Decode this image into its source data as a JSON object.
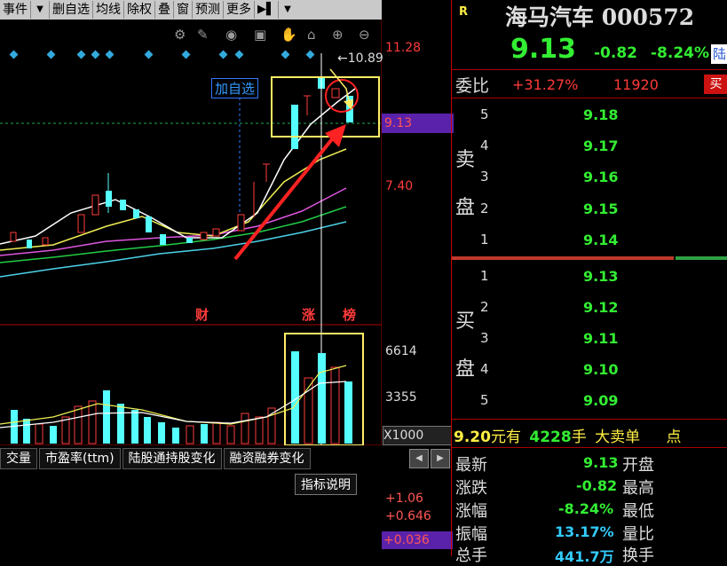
{
  "toolbar": {
    "items": [
      "事件",
      "删自选",
      "均线",
      "除权",
      "叠",
      "窗",
      "预测",
      "更多"
    ],
    "dropdown_arrow": "▼",
    "icons": [
      "settings-icon",
      "pen-icon",
      "eye-icon",
      "briefcase-icon",
      "hand-icon",
      "lock-icon",
      "zoom-in-icon",
      "zoom-out-icon"
    ]
  },
  "chart": {
    "add_watchlist": "加自选",
    "price_high_label": "10.89",
    "axis_prices": [
      "11.28",
      "7.40"
    ],
    "current_price_tag": "9.13",
    "markers": [
      "财",
      "涨",
      "榜"
    ],
    "volume_axis": [
      "6614",
      "3355"
    ],
    "volume_unit": "X1000",
    "indicator_button": "指标说明",
    "indicator_values": [
      "+1.06",
      "+0.646",
      "+0.036"
    ],
    "colors": {
      "up": "#ff3b3b",
      "down": "#55ffff",
      "highlight_box": "#ffee66",
      "arrow": "#ff2222"
    }
  },
  "tabs": [
    "交量",
    "市盈率(ttm)",
    "陆股通持股变化",
    "融资融券变化"
  ],
  "stock": {
    "badge": "R",
    "name": "海马汽车",
    "code": "000572",
    "price": "9.13",
    "change": "-0.82",
    "change_pct": "-8.24%",
    "lu_tag": "陆"
  },
  "order_ratio": {
    "label": "委比",
    "pct": "+31.27%",
    "vol": "11920",
    "tag": "买"
  },
  "sell": {
    "label_chars": [
      "卖",
      "盘"
    ],
    "rows": [
      {
        "n": "5",
        "p": "9.18"
      },
      {
        "n": "4",
        "p": "9.17"
      },
      {
        "n": "3",
        "p": "9.16"
      },
      {
        "n": "2",
        "p": "9.15"
      },
      {
        "n": "1",
        "p": "9.14"
      }
    ]
  },
  "buy": {
    "label_chars": [
      "买",
      "盘"
    ],
    "rows": [
      {
        "n": "1",
        "p": "9.13"
      },
      {
        "n": "2",
        "p": "9.12"
      },
      {
        "n": "3",
        "p": "9.11"
      },
      {
        "n": "4",
        "p": "9.10"
      },
      {
        "n": "5",
        "p": "9.09"
      }
    ]
  },
  "big_order": {
    "price": "9.20",
    "yuan": "元有",
    "qty": "4228",
    "unit": "手",
    "type": "大卖单",
    "extra": "点"
  },
  "stats": [
    {
      "k": "最新",
      "v": "9.13",
      "k2": "开盘"
    },
    {
      "k": "涨跌",
      "v": "-0.82",
      "k2": "最高"
    },
    {
      "k": "涨幅",
      "v": "-8.24%",
      "k2": "最低"
    },
    {
      "k": "振幅",
      "v": "13.17%",
      "k2": "量比"
    },
    {
      "k": "总手",
      "v": "441.7万",
      "k2": "换手"
    }
  ]
}
